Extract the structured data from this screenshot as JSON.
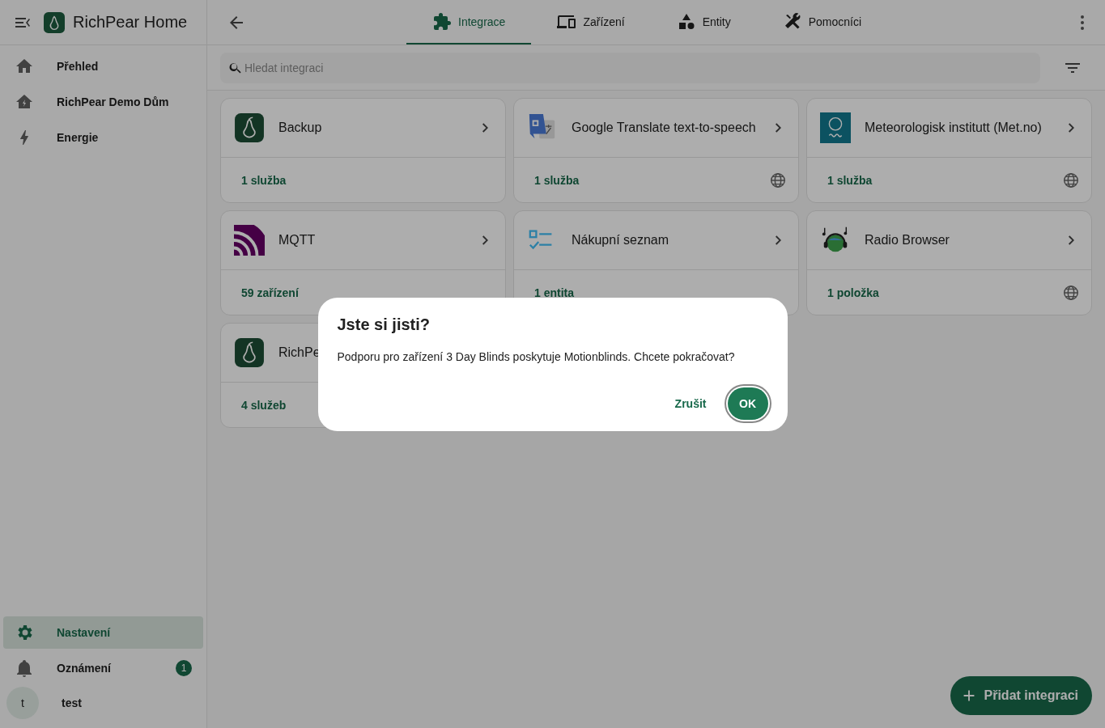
{
  "app": {
    "title": "RichPear Home"
  },
  "sidebar": {
    "items": [
      {
        "label": "Přehled",
        "selected": false
      },
      {
        "label": "RichPear Demo Dům",
        "selected": false
      },
      {
        "label": "Energie",
        "selected": false
      }
    ],
    "bottom_items": [
      {
        "label": "Nastavení",
        "selected": true
      },
      {
        "label": "Oznámení",
        "selected": false,
        "badge": "1"
      }
    ],
    "user": {
      "initial": "t",
      "name": "test"
    }
  },
  "tabs": [
    {
      "label": "Integrace",
      "selected": true
    },
    {
      "label": "Zařízení",
      "selected": false
    },
    {
      "label": "Entity",
      "selected": false
    },
    {
      "label": "Pomocníci",
      "selected": false
    }
  ],
  "search": {
    "placeholder": "Hledat integraci"
  },
  "integrations": [
    {
      "name": "Backup",
      "summary": "1 služba",
      "cloud": false
    },
    {
      "name": "Google Translate text-to-speech",
      "summary": "1 služba",
      "cloud": true
    },
    {
      "name": "Meteorologisk institutt (Met.no)",
      "summary": "1 služba",
      "cloud": true
    },
    {
      "name": "MQTT",
      "summary": "59 zařízení",
      "cloud": false
    },
    {
      "name": "Nákupní seznam",
      "summary": "1 entita",
      "cloud": false
    },
    {
      "name": "Radio Browser",
      "summary": "1 položka",
      "cloud": true
    },
    {
      "name": "RichPe",
      "summary": "4 služeb",
      "cloud": false
    }
  ],
  "fab": {
    "label": "Přidat integraci"
  },
  "dialog": {
    "title": "Jste si jisti?",
    "message": "Podporu pro zařízení 3 Day Blinds poskytuje Motionblinds. Chcete pokračovat?",
    "buttons": [
      {
        "label": "Zrušit",
        "kind": "text"
      },
      {
        "label": "OK",
        "kind": "filled"
      }
    ]
  }
}
